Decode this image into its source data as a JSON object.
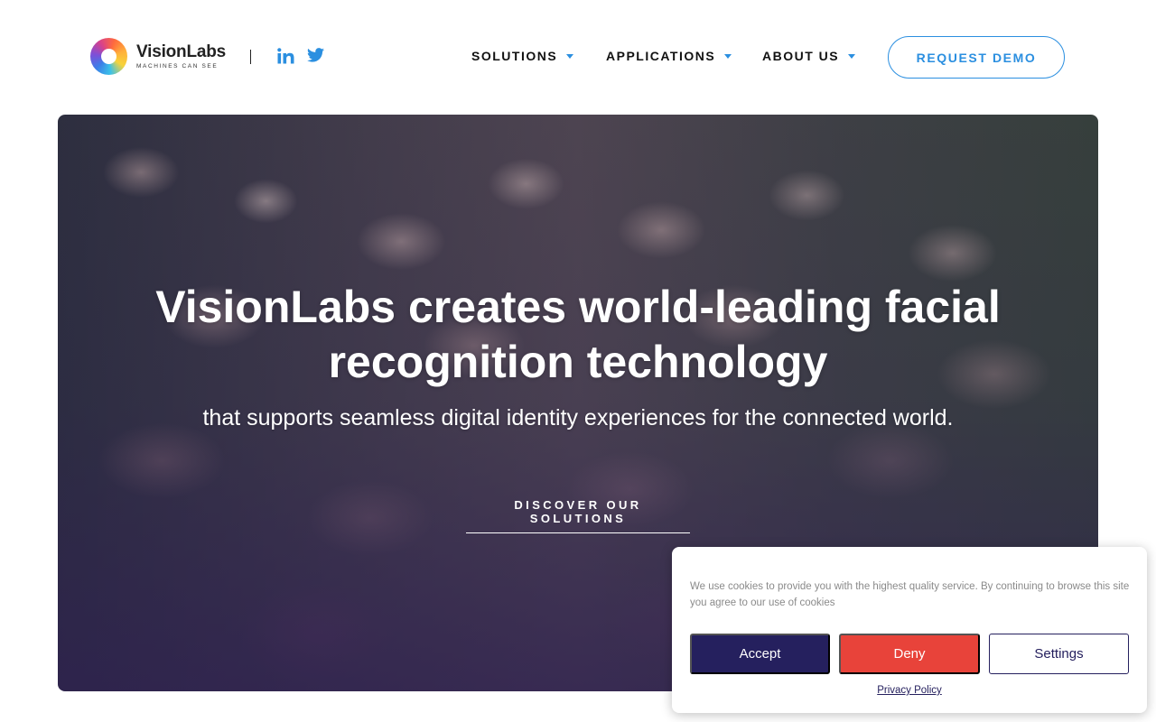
{
  "header": {
    "logo": {
      "name": "VisionLabs",
      "tagline": "MACHINES CAN SEE"
    },
    "social": [
      {
        "icon": "linkedin-icon"
      },
      {
        "icon": "twitter-icon"
      }
    ],
    "nav": [
      {
        "label": "SOLUTIONS"
      },
      {
        "label": "APPLICATIONS"
      },
      {
        "label": "ABOUT US"
      }
    ],
    "cta_label": "REQUEST DEMO"
  },
  "hero": {
    "title_plain": "VisionLabs creates ",
    "title_bold": "world-leading facial recognition technology",
    "subtitle": "that supports seamless digital identity experiences for the connected world.",
    "cta_label": "DISCOVER OUR SOLUTIONS"
  },
  "cookie": {
    "text": "We use cookies to provide you with the highest quality service. By continuing to browse this site you agree to our use of cookies",
    "accept_label": "Accept",
    "deny_label": "Deny",
    "settings_label": "Settings",
    "privacy_label": "Privacy Policy"
  },
  "colors": {
    "accent": "#2b8fe0",
    "brand_dark": "#25205e",
    "deny": "#e8433a"
  }
}
